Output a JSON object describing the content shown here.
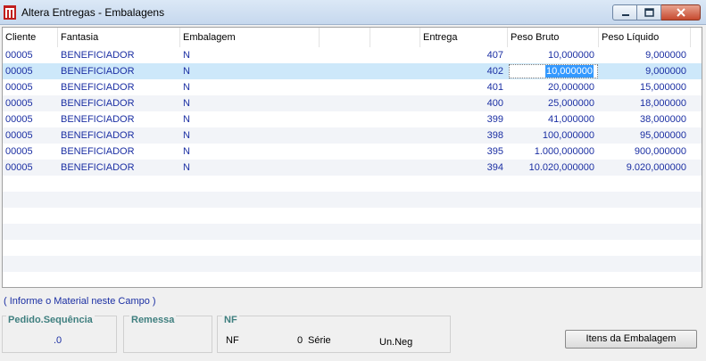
{
  "window": {
    "title": "Altera Entregas - Embalagens"
  },
  "columns": [
    "Cliente",
    "Fantasia",
    "Embalagem",
    "",
    "",
    "Entrega",
    "Peso Bruto",
    "Peso Líquido"
  ],
  "rows": [
    {
      "cliente": "00005",
      "fantasia": "BENEFICIADOR",
      "embalagem": "N",
      "entrega": "407",
      "peso_bruto": "10,000000",
      "peso_liquido": "9,000000"
    },
    {
      "cliente": "00005",
      "fantasia": "BENEFICIADOR",
      "embalagem": "N",
      "entrega": "402",
      "peso_bruto": "10,000000",
      "peso_liquido": "9,000000"
    },
    {
      "cliente": "00005",
      "fantasia": "BENEFICIADOR",
      "embalagem": "N",
      "entrega": "401",
      "peso_bruto": "20,000000",
      "peso_liquido": "15,000000"
    },
    {
      "cliente": "00005",
      "fantasia": "BENEFICIADOR",
      "embalagem": "N",
      "entrega": "400",
      "peso_bruto": "25,000000",
      "peso_liquido": "18,000000"
    },
    {
      "cliente": "00005",
      "fantasia": "BENEFICIADOR",
      "embalagem": "N",
      "entrega": "399",
      "peso_bruto": "41,000000",
      "peso_liquido": "38,000000"
    },
    {
      "cliente": "00005",
      "fantasia": "BENEFICIADOR",
      "embalagem": "N",
      "entrega": "398",
      "peso_bruto": "100,000000",
      "peso_liquido": "95,000000"
    },
    {
      "cliente": "00005",
      "fantasia": "BENEFICIADOR",
      "embalagem": "N",
      "entrega": "395",
      "peso_bruto": "1.000,000000",
      "peso_liquido": "900,000000"
    },
    {
      "cliente": "00005",
      "fantasia": "BENEFICIADOR",
      "embalagem": "N",
      "entrega": "394",
      "peso_bruto": "10.020,000000",
      "peso_liquido": "9.020,000000"
    }
  ],
  "selected_row": 1,
  "hint": "( Informe o Material neste Campo )",
  "pedido": {
    "title": "Pedido.Sequência",
    "value": ".0"
  },
  "remessa": {
    "title": "Remessa"
  },
  "nf": {
    "title": "NF",
    "nf_label": "NF",
    "nf_value": "0",
    "serie_label": "Série",
    "unneg_label": "Un.Neg"
  },
  "buttons": {
    "itens_label": "Itens da Embalagem"
  },
  "colors": {
    "row_text": "#1b2fa3",
    "selected": "#cde8fa",
    "group_title": "#3f7f7f"
  }
}
